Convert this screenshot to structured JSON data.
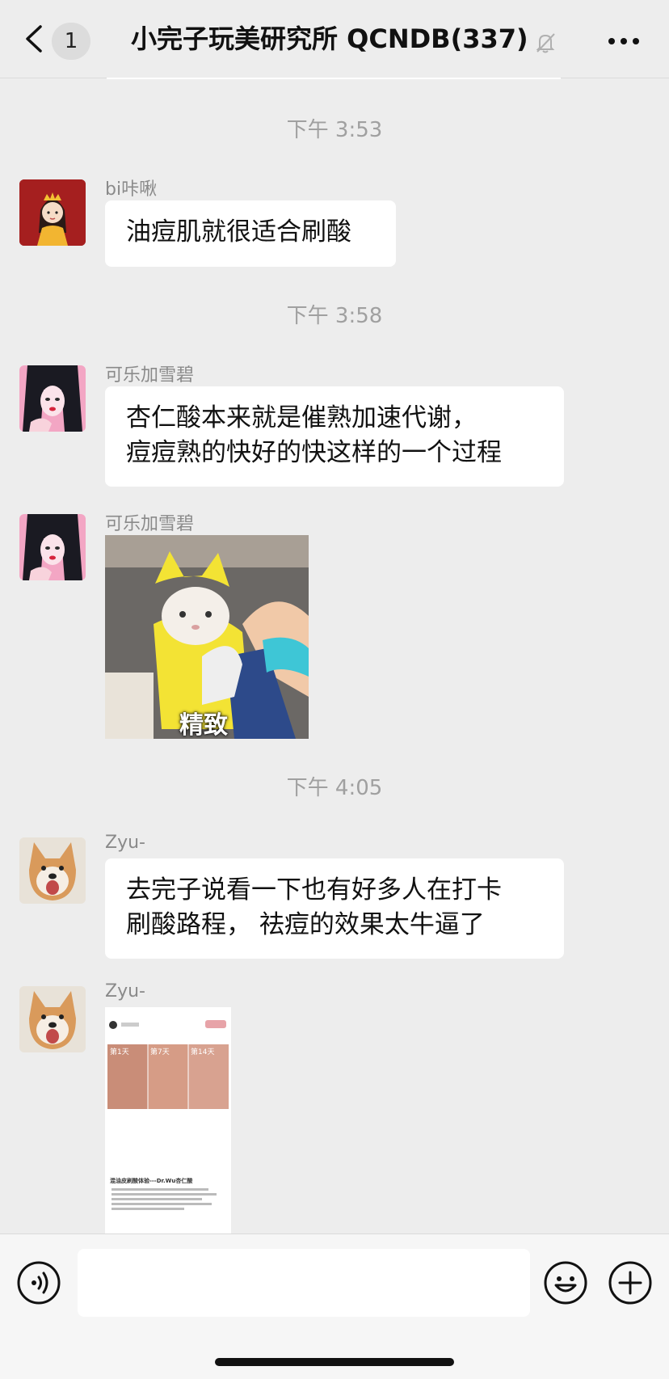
{
  "header": {
    "back_badge": "1",
    "title": "小完子玩美研究所 QCNDB(337)",
    "icons": {
      "back": "chevron-left-icon",
      "mute": "bell-muted-icon",
      "more": "more-dots-icon"
    }
  },
  "messages": [
    {
      "type": "time",
      "text": "下午 3:53"
    },
    {
      "type": "text",
      "sender": "bi咔啾",
      "avatar": "cartoon-girl-crown-avatar",
      "lines": [
        "油痘肌就很适合刷酸"
      ]
    },
    {
      "type": "time",
      "text": "下午 3:58"
    },
    {
      "type": "text",
      "sender": "可乐加雪碧",
      "avatar": "anime-girl-pink-avatar",
      "lines": [
        "杏仁酸本来就是催熟加速代谢，",
        "痘痘熟的快好的快这样的一个过程"
      ]
    },
    {
      "type": "sticker",
      "sender": "可乐加雪碧",
      "avatar": "anime-girl-pink-avatar",
      "caption": "精致"
    },
    {
      "type": "time",
      "text": "下午 4:05"
    },
    {
      "type": "text",
      "sender": "Zyu-",
      "avatar": "shiba-dog-avatar",
      "lines": [
        "去完子说看一下也有好多人在打卡",
        "刷酸路程， 祛痘的效果太牛逼了"
      ]
    },
    {
      "type": "screenshot",
      "sender": "Zyu-",
      "avatar": "shiba-dog-avatar",
      "labels": [
        "第1天",
        "第7天",
        "第14天"
      ],
      "heading": "混油皮刷酸体验---Dr.Wu杏仁酸"
    }
  ],
  "input_bar": {
    "icons": {
      "voice": "voice-icon",
      "emoji": "emoji-smile-icon",
      "plus": "plus-circle-icon"
    },
    "value": "",
    "placeholder": ""
  },
  "colors": {
    "background": "#ededed",
    "bubble": "#ffffff",
    "timestamp": "#a0a0a0",
    "sender_name": "#8a8a8a"
  }
}
